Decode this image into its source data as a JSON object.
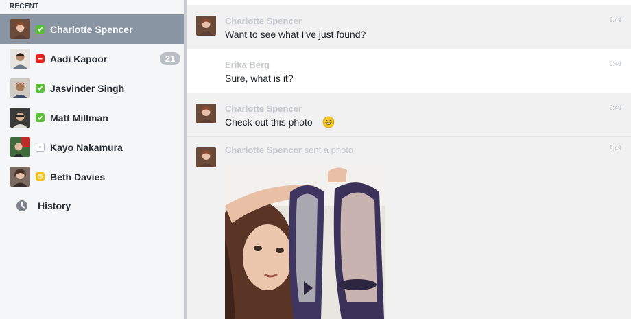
{
  "sidebar": {
    "section": "RECENT",
    "contacts": [
      {
        "name": "Charlotte Spencer",
        "status": "online",
        "selected": true
      },
      {
        "name": "Aadi Kapoor",
        "status": "busy",
        "badge": "21"
      },
      {
        "name": "Jasvinder Singh",
        "status": "online"
      },
      {
        "name": "Matt Millman",
        "status": "online"
      },
      {
        "name": "Kayo Nakamura",
        "status": "offline"
      },
      {
        "name": "Beth Davies",
        "status": "away"
      }
    ],
    "history_label": "History"
  },
  "messages": [
    {
      "sender": "Charlotte Spencer",
      "text": "Want to see what I've just found?",
      "time": "9:49"
    },
    {
      "sender": "Erika Berg",
      "text": "Sure, what is it?",
      "time": "9:49"
    },
    {
      "sender": "Charlotte Spencer",
      "text": "Check out this photo",
      "time": "9:49",
      "emoji": "grinning-emoji"
    },
    {
      "sender": "Charlotte Spencer",
      "sender_extra": "sent a photo",
      "time": "9:49",
      "photo": "shared-photo"
    }
  ],
  "colors": {
    "online": "#5bbd36",
    "busy": "#e8231f",
    "away": "#f5c418",
    "offline": "#b9bec4",
    "selected_row": "#8a95a3"
  }
}
